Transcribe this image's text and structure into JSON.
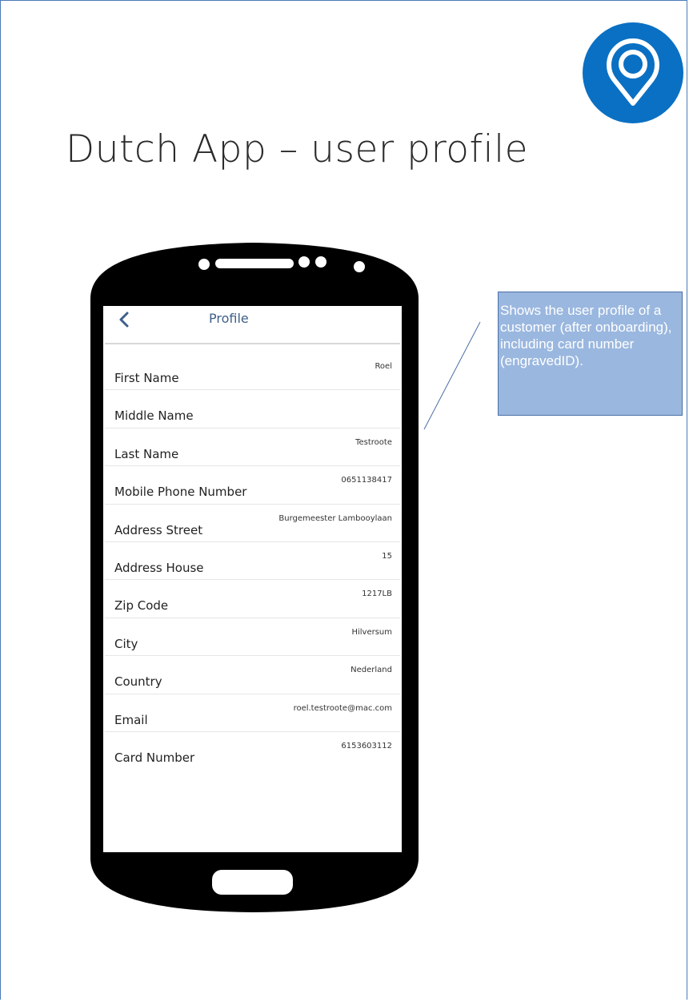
{
  "slide": {
    "title": "Dutch App – user profile",
    "logo_icon": "map-pin-icon",
    "accent_color": "#0a70c3"
  },
  "app": {
    "nav": {
      "back_icon": "chevron-left-icon",
      "title": "Profile"
    },
    "fields": [
      {
        "label": "First Name",
        "value": "Roel"
      },
      {
        "label": "Middle Name",
        "value": ""
      },
      {
        "label": "Last Name",
        "value": "Testroote"
      },
      {
        "label": "Mobile Phone Number",
        "value": "0651138417"
      },
      {
        "label": "Address Street",
        "value": "Burgemeester Lambooylaan"
      },
      {
        "label": "Address House",
        "value": "15"
      },
      {
        "label": "Zip Code",
        "value": "1217LB"
      },
      {
        "label": "City",
        "value": "Hilversum"
      },
      {
        "label": "Country",
        "value": "Nederland"
      },
      {
        "label": "Email",
        "value": "roel.testroote@mac.com"
      },
      {
        "label": "Card Number",
        "value": "6153603112"
      }
    ]
  },
  "callout": {
    "text": "Shows the user profile of a customer (after onboarding), including card number (engravedID).",
    "background": "#9ab7df"
  }
}
